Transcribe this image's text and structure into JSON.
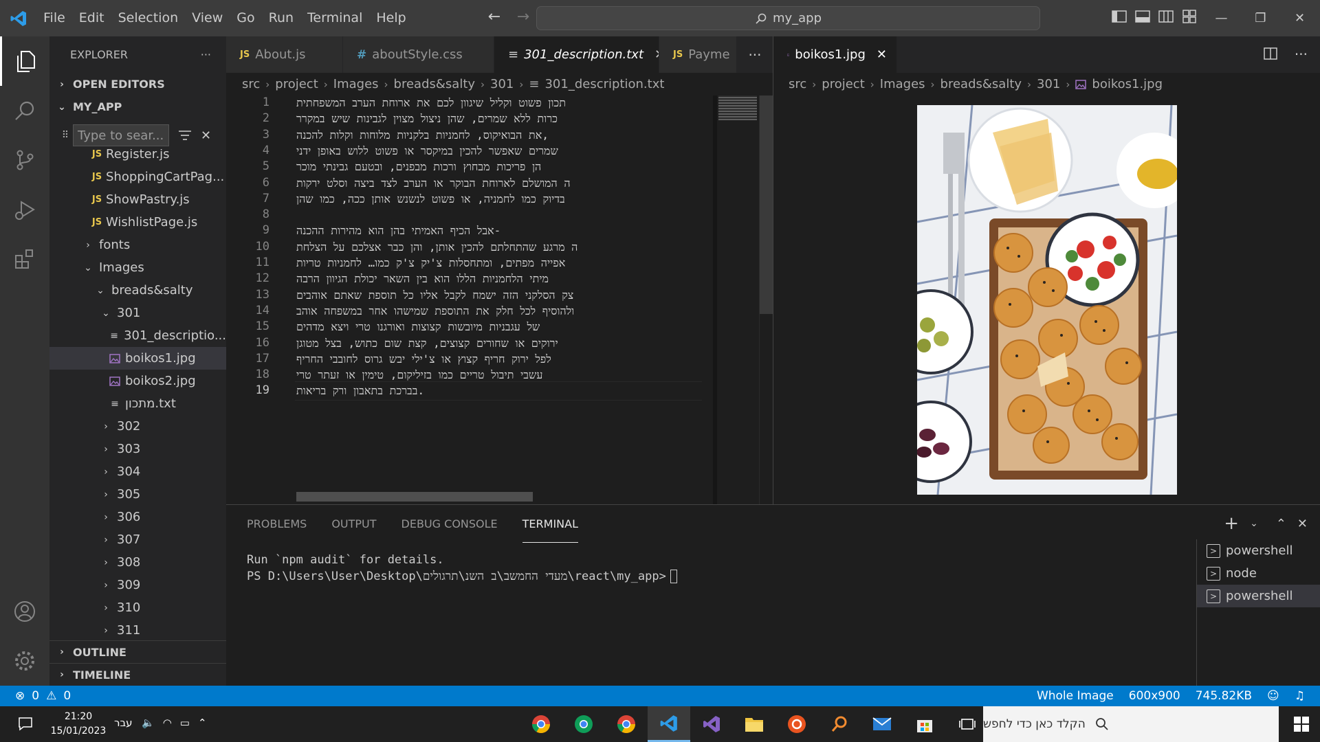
{
  "titlebar": {
    "menu": [
      "File",
      "Edit",
      "Selection",
      "View",
      "Go",
      "Run",
      "Terminal",
      "Help"
    ],
    "search_text": "my_app"
  },
  "sidebar": {
    "title": "EXPLORER",
    "open_editors": "OPEN EDITORS",
    "project": "MY_APP",
    "filter_placeholder": "Type to sear...",
    "files_top": [
      {
        "name": "Register.js",
        "type": "js"
      },
      {
        "name": "ShoppingCartPag...",
        "type": "js"
      },
      {
        "name": "ShowPastry.js",
        "type": "js"
      },
      {
        "name": "WishlistPage.js",
        "type": "js"
      }
    ],
    "folders": {
      "fonts": "fonts",
      "images": "Images",
      "breads": "breads&salty",
      "f301": "301"
    },
    "files_301": [
      {
        "name": "301_descriptio...",
        "type": "txt"
      },
      {
        "name": "boikos1.jpg",
        "type": "img"
      },
      {
        "name": "boikos2.jpg",
        "type": "img"
      },
      {
        "name": "מתכון.txt",
        "type": "txt"
      }
    ],
    "subfolders": [
      "302",
      "303",
      "304",
      "305",
      "306",
      "307",
      "308",
      "309",
      "310",
      "311"
    ],
    "outline": "OUTLINE",
    "timeline": "TIMELINE"
  },
  "editor1": {
    "tabs": [
      {
        "label": "About.js",
        "type": "js"
      },
      {
        "label": "aboutStyle.css",
        "type": "css"
      },
      {
        "label": "301_description.txt",
        "type": "txt"
      },
      {
        "label": "Payme",
        "type": "js"
      }
    ],
    "breadcrumbs": [
      "src",
      "project",
      "Images",
      "breads&salty",
      "301",
      "301_description.txt"
    ],
    "line_numbers": [
      "1",
      "2",
      "3",
      "4",
      "5",
      "6",
      "7",
      "8",
      "9",
      "10",
      "11",
      "12",
      "13",
      "14",
      "15",
      "16",
      "17",
      "18",
      "19"
    ],
    "lines": [
      "תכון פשוט וקליל שיגוון לכם את ארוחת הערב המשפחתית",
      "כרות ללא שמרים, שהן ניצול מצוין לגבינות שיש במקרר",
      ",את הבואיקוס, לחמניות בלקניות מלוחות וקלות להכנה",
      "שמרים שאפשר להכין במיקסר או פשוט ללוש באופן ידני",
      "הן פריכות מבחוץ ורכות מבפנים, ובטעם גבינתי מוכר",
      "ה המושלם לארוחת הבוקר או הערב לצד ביצה וסלט ירקות",
      "בדיוק כמו לחמניה, או פשוט לנשנש אותן ככה, כמו שהן",
      "",
      "-אבל הכיף האמיתי בהן הוא מהירות ההכנה",
      "ה מרגע שהתחלתם להכין אותן, והן כבר אצלכם על הצלחת",
      "אפייה מפתים, ומתחסלות צ'יק צ'ק כמו… לחמניות טריות",
      "מיתי הלחמניות הללו הוא בין השאר יכולת הגיוון הרבה",
      "צק הסלקני הזה ישמח לקבל אליו כל תוספת שאתם אוהבים",
      "ולהוסיף לכל חלק את התוספת שמישהו אחר במשפחה אוהב",
      "של עגבניות מיובשות קצוצות ואורגנו טרי ויצא מדהים",
      "ירוקים או שחורים קצוצים, קצת שום כתוש, בצל מטוגן",
      "לפל ירוק חריף קצוץ או צ'ילי יבש גרוס לחובבי החריף",
      "עשבי תיבול טריים כמו בזיליקום, טימין או זעתר טרי",
      ".בברכת בתאבון ורק בריאות"
    ]
  },
  "editor2": {
    "tab": "boikos1.jpg",
    "breadcrumbs": [
      "src",
      "project",
      "Images",
      "breads&salty",
      "301",
      "boikos1.jpg"
    ]
  },
  "panel": {
    "tabs": [
      "PROBLEMS",
      "OUTPUT",
      "DEBUG CONSOLE",
      "TERMINAL"
    ],
    "active_tab": "TERMINAL",
    "terminal_lines": [
      "Run `npm audit` for details.",
      "PS D:\\Users\\User\\Desktop\\מעדי החמשב\\ב השנ\\תרגולים\\react\\my_app>"
    ],
    "terminals": [
      "powershell",
      "node",
      "powershell"
    ]
  },
  "statusbar": {
    "errors": "0",
    "warnings": "0",
    "mode": "Whole Image",
    "dimensions": "600x900",
    "size": "745.82KB"
  },
  "taskbar": {
    "time": "21:20",
    "date": "15/01/2023",
    "lang": "עבר",
    "search_placeholder": "הקלד כאן כדי לחפש"
  },
  "colors": {
    "accent": "#007acc",
    "js": "#e8c74d",
    "css": "#519aba",
    "image_icon": "#a074c4"
  }
}
